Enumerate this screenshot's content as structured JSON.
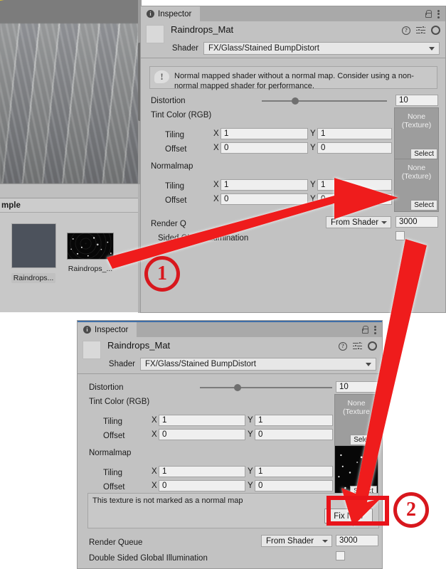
{
  "app": "Unity Editor",
  "scene_view": {
    "name": "scene-view",
    "description": "grey brick wall with yellow diagonal stripe"
  },
  "project_browser": {
    "breadcrumb": "mple",
    "assets": [
      {
        "label": "Raindrops...",
        "type": "material",
        "selected": true
      },
      {
        "label": "Raindrops_...",
        "type": "texture",
        "selected": false
      }
    ]
  },
  "inspector_top": {
    "tab_label": "Inspector",
    "material_name": "Raindrops_Mat",
    "shader_label": "Shader",
    "shader_value": "FX/Glass/Stained BumpDistort",
    "warning": "Normal mapped shader without a normal map. Consider using a non-normal mapped shader for performance.",
    "distortion_label": "Distortion",
    "distortion_value": "10",
    "distortion_slider_pct": 27,
    "tint_label": "Tint Color (RGB)",
    "normalmap_label": "Normalmap",
    "tiling_label": "Tiling",
    "offset_label": "Offset",
    "axis_x": "X",
    "axis_y": "Y",
    "tint_tiling_x": "1",
    "tint_tiling_y": "1",
    "tint_offset_x": "0",
    "tint_offset_y": "0",
    "normal_tiling_x": "1",
    "normal_tiling_y": "1",
    "normal_offset_x": "0",
    "normal_offset_y": "0",
    "tint_texture": "None\n(Texture)",
    "tint_texture_line1": "None",
    "tint_texture_line2": "(Texture)",
    "normal_texture_line1": "None",
    "normal_texture_line2": "(Texture)",
    "select_label": "Select",
    "render_queue_label": "Render Q",
    "render_queue_mode": "From Shader",
    "render_queue_value": "3000",
    "double_sided_label": "Sided Global Illumination",
    "double_sided_checked": false
  },
  "inspector_bottom": {
    "tab_label": "Inspector",
    "material_name": "Raindrops_Mat",
    "shader_label": "Shader",
    "shader_value": "FX/Glass/Stained BumpDistort",
    "distortion_label": "Distortion",
    "distortion_value": "10",
    "distortion_slider_pct": 27,
    "tint_label": "Tint Color (RGB)",
    "normalmap_label": "Normalmap",
    "tiling_label": "Tiling",
    "offset_label": "Offset",
    "axis_x": "X",
    "axis_y": "Y",
    "tint_tiling_x": "1",
    "tint_tiling_y": "1",
    "tint_offset_x": "0",
    "tint_offset_y": "0",
    "normal_tiling_x": "1",
    "normal_tiling_y": "1",
    "normal_offset_x": "0",
    "normal_offset_y": "0",
    "tint_texture_line1": "None",
    "tint_texture_line2": "(Texture",
    "select_label": "Select",
    "normalmap_texture_assigned": true,
    "fix_message": "This texture is not marked as a normal map",
    "fix_button": "Fix Now",
    "render_queue_label": "Render Queue",
    "render_queue_mode": "From Shader",
    "render_queue_value": "3000",
    "double_sided_label": "Double Sided Global Illumination",
    "double_sided_checked": false
  },
  "annotations": {
    "accent_color": "#e8131a",
    "marker_one": "1",
    "marker_two": "2",
    "arrow_one_desc": "red arrow pointing from asset thumbnail to Normalmap texture slot",
    "arrow_two_desc": "red arrow pointing from upper panel down to Fix Now button"
  }
}
